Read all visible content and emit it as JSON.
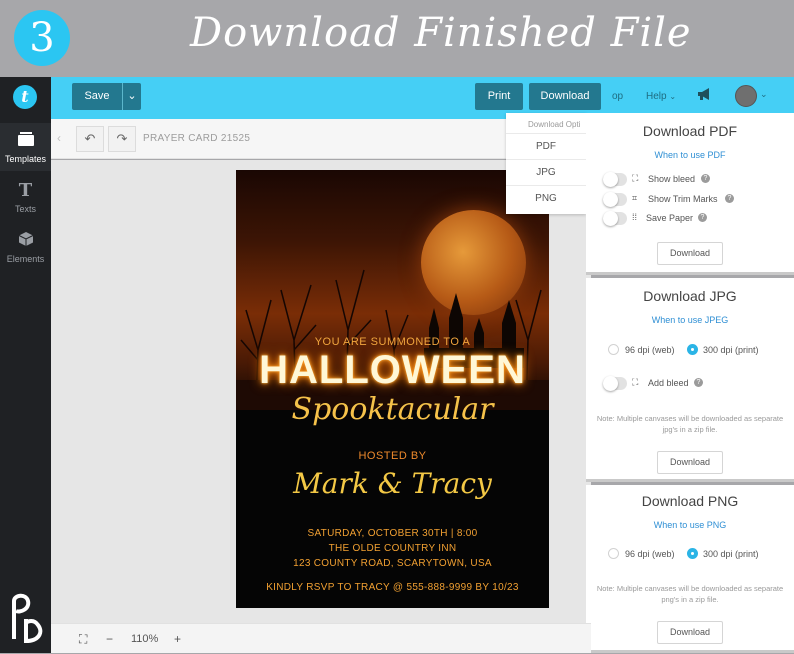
{
  "banner": {
    "step": "3",
    "title": "Download Finished File"
  },
  "sidebar": {
    "logo": "t",
    "items": [
      {
        "label": "Templates",
        "icon": "templates-icon"
      },
      {
        "label": "Texts",
        "icon": "text-icon"
      },
      {
        "label": "Elements",
        "icon": "cube-icon"
      }
    ],
    "brand_mark": "PD"
  },
  "topbar": {
    "save": "Save",
    "print": "Print",
    "download": "Download",
    "op": "op",
    "help": "Help"
  },
  "toolbar": {
    "doc_name": "PRAYER CARD 21525"
  },
  "card": {
    "summoned": "YOU ARE SUMMONED TO A",
    "halloween": "HALLOWEEN",
    "spooktacular": "Spooktacular",
    "hosted_by": "HOSTED BY",
    "names": "Mark & Tracy",
    "line1": "SATURDAY, OCTOBER 30TH | 8:00",
    "line2": "THE OLDE COUNTRY INN",
    "line3": "123 COUNTY ROAD, SCARYTOWN, USA",
    "rsvp": "KINDLY RSVP TO TRACY  @ 555-888-9999 BY 10/23"
  },
  "download_menu": {
    "title": "Download Opti",
    "items": [
      "PDF",
      "JPG",
      "PNG"
    ]
  },
  "pdf_panel": {
    "title": "Download PDF",
    "link": "When to use PDF",
    "options": [
      "Show bleed",
      "Show Trim Marks",
      "Save Paper"
    ],
    "button": "Download"
  },
  "jpg_panel": {
    "title": "Download JPG",
    "link": "When to use JPEG",
    "dpi_web": "96 dpi (web)",
    "dpi_print": "300 dpi (print)",
    "selected": "300 dpi (print)",
    "bleed": "Add bleed",
    "note": "Note: Multiple canvases will be downloaded as separate jpg's in a zip file.",
    "button": "Download"
  },
  "png_panel": {
    "title": "Download PNG",
    "link": "When to use PNG",
    "dpi_web": "96 dpi (web)",
    "dpi_print": "300 dpi (print)",
    "selected": "300 dpi (print)",
    "note": "Note: Multiple canvases will be downloaded as separate png's in a zip file.",
    "button": "Download"
  },
  "zoom": {
    "level": "110%",
    "minus": "−",
    "plus": "+"
  },
  "colors": {
    "accent": "#45cff5",
    "button_dark": "#23788f",
    "sidebar": "#1f2124",
    "link": "#2f8fd4"
  }
}
